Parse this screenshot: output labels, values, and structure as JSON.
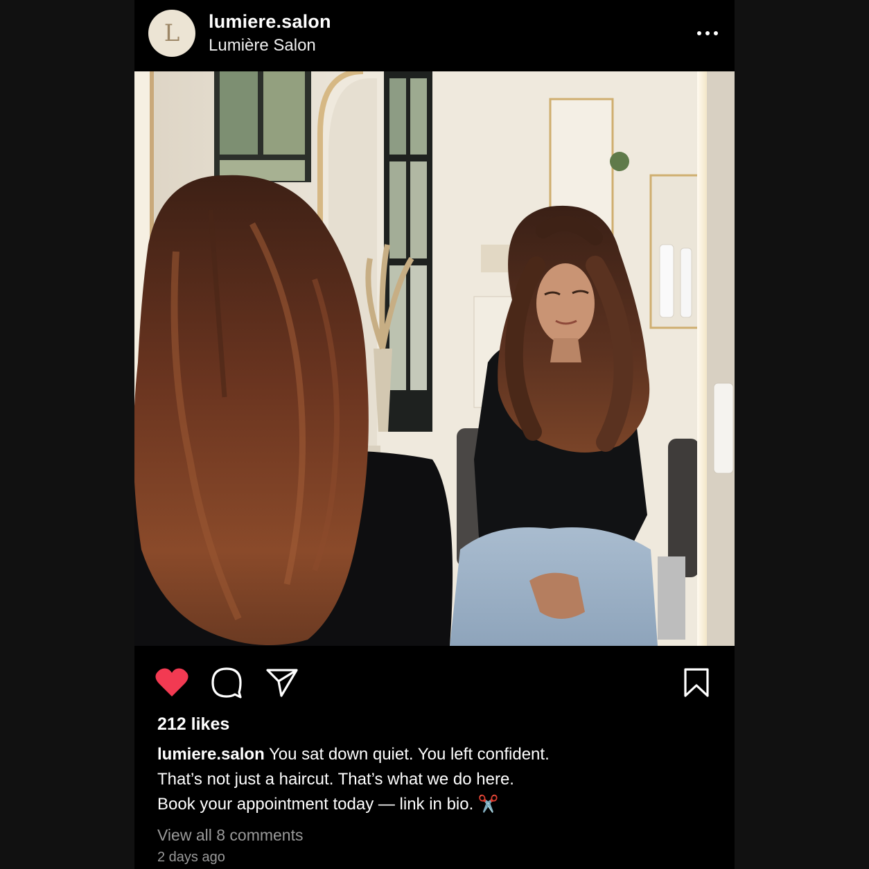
{
  "post": {
    "avatar_letter": "L",
    "username": "lumiere.salon",
    "display_name": "Lumière Salon",
    "more_icon": "more-horizontal-icon",
    "photo_alt": "",
    "actions": {
      "like_icon": "heart-filled-icon",
      "comment_icon": "comment-bubble-icon",
      "share_icon": "paper-plane-icon",
      "save_icon": "bookmark-icon",
      "liked": true,
      "like_color": "#f23a52"
    },
    "likes_text": "212 likes",
    "caption": {
      "username": "lumiere.salon",
      "line1": "You sat down quiet. You left confident.",
      "line2": "That’s not just a haircut. That’s what we do here.",
      "line3": "Book your appointment today — link in bio. ✂️"
    },
    "view_comments": "View all 8 comments",
    "timestamp": "2 days ago"
  },
  "colors": {
    "page_background": "#111111",
    "post_background": "#000000",
    "avatar_background": "#ece4d4",
    "muted_text": "#9a9a9a"
  }
}
